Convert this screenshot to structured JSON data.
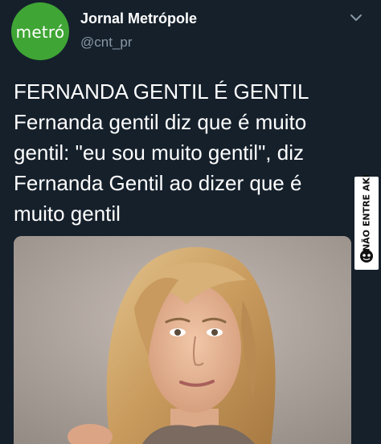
{
  "account": {
    "name": "Jornal Metrópole",
    "handle": "@cnt_pr",
    "avatar_text": "metró",
    "avatar_color": "#3fa535"
  },
  "tweet": {
    "text": "FERNANDA GENTIL É GENTIL Fernanda gentil diz que é muito gentil: \"eu sou muito gentil\", diz Fernanda Gentil ao dizer que é muito gentil"
  },
  "watermark": {
    "text": "NÃO ENTRE AKI"
  },
  "colors": {
    "background": "#15202b",
    "handle": "#8899a6"
  },
  "icons": {
    "menu": "chevron-down-icon"
  }
}
